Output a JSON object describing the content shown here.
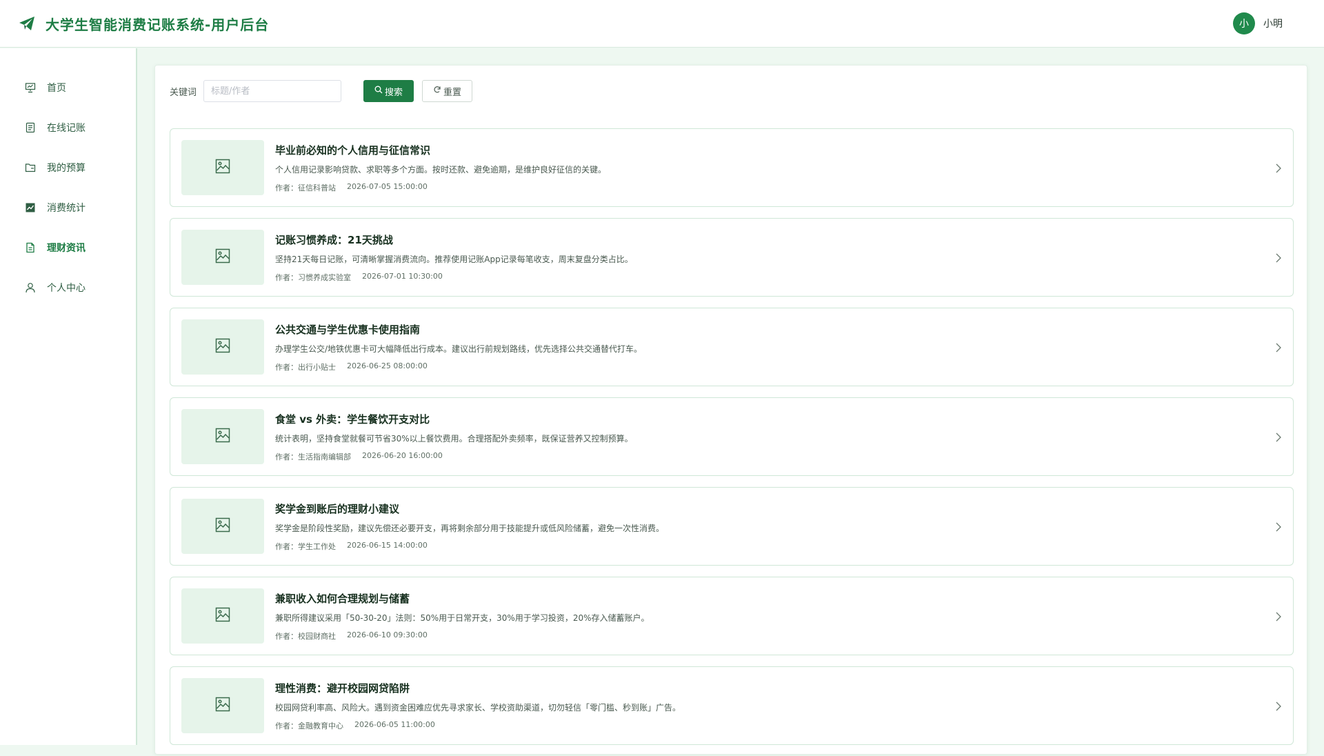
{
  "header": {
    "title": "大学生智能消费记账系统-用户后台",
    "brand_icon": "paper-plane-icon",
    "user": {
      "avatar_text": "小",
      "name": "小明"
    }
  },
  "colors": {
    "primary": "#1e7d45",
    "background": "#eef8f1",
    "thumb_bg": "#e6f4ea"
  },
  "sidebar": {
    "items": [
      {
        "label": "首页",
        "icon": "presentation-icon",
        "active": false
      },
      {
        "label": "在线记账",
        "icon": "document-icon",
        "active": false
      },
      {
        "label": "我的预算",
        "icon": "folder-icon",
        "active": false
      },
      {
        "label": "消费统计",
        "icon": "chart-icon",
        "active": false
      },
      {
        "label": "理财资讯",
        "icon": "article-icon",
        "active": true
      },
      {
        "label": "个人中心",
        "icon": "user-icon",
        "active": false
      }
    ]
  },
  "search": {
    "label": "关键词",
    "placeholder": "标题/作者",
    "value": "",
    "search_label": "搜索",
    "reset_label": "重置"
  },
  "articles": [
    {
      "title": "毕业前必知的个人信用与征信常识",
      "summary": "个人信用记录影响贷款、求职等多个方面。按时还款、避免逾期，是维护良好征信的关键。",
      "author": "作者：征信科普站",
      "time": "2026-07-05 15:00:00"
    },
    {
      "title": "记账习惯养成：21天挑战",
      "summary": "坚持21天每日记账，可清晰掌握消费流向。推荐使用记账App记录每笔收支，周末复盘分类占比。",
      "author": "作者：习惯养成实验室",
      "time": "2026-07-01 10:30:00"
    },
    {
      "title": "公共交通与学生优惠卡使用指南",
      "summary": "办理学生公交/地铁优惠卡可大幅降低出行成本。建议出行前规划路线，优先选择公共交通替代打车。",
      "author": "作者：出行小贴士",
      "time": "2026-06-25 08:00:00"
    },
    {
      "title": "食堂 vs 外卖：学生餐饮开支对比",
      "summary": "统计表明，坚持食堂就餐可节省30%以上餐饮费用。合理搭配外卖频率，既保证营养又控制预算。",
      "author": "作者：生活指南编辑部",
      "time": "2026-06-20 16:00:00"
    },
    {
      "title": "奖学金到账后的理财小建议",
      "summary": "奖学金是阶段性奖励，建议先偿还必要开支，再将剩余部分用于技能提升或低风险储蓄，避免一次性消费。",
      "author": "作者：学生工作处",
      "time": "2026-06-15 14:00:00"
    },
    {
      "title": "兼职收入如何合理规划与储蓄",
      "summary": "兼职所得建议采用「50-30-20」法则：50%用于日常开支，30%用于学习投资，20%存入储蓄账户。",
      "author": "作者：校园财商社",
      "time": "2026-06-10 09:30:00"
    },
    {
      "title": "理性消费：避开校园网贷陷阱",
      "summary": "校园网贷利率高、风险大。遇到资金困难应优先寻求家长、学校资助渠道，切勿轻信「零门槛、秒到账」广告。",
      "author": "作者：金融教育中心",
      "time": "2026-06-05 11:00:00"
    }
  ]
}
